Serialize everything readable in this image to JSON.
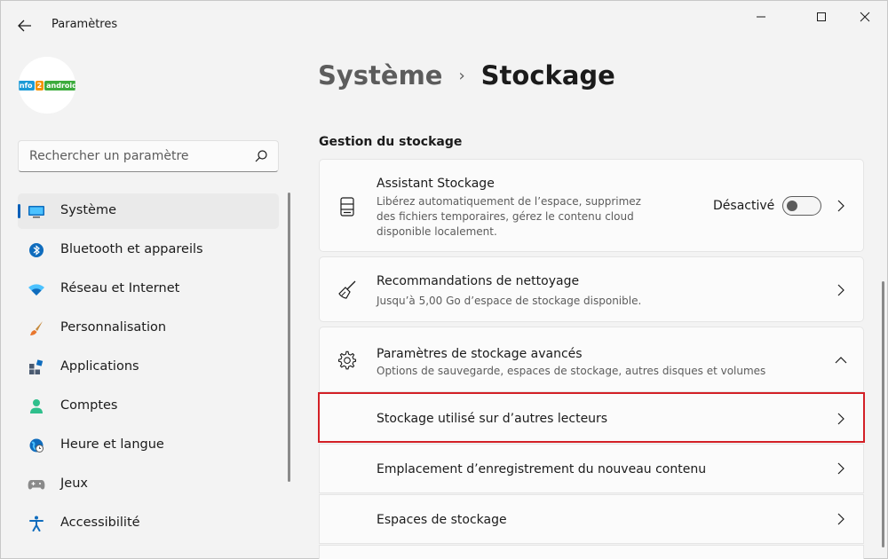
{
  "app": {
    "title": "Paramètres",
    "logo": {
      "part1": "info",
      "part2": "2",
      "part3": "android"
    }
  },
  "search": {
    "placeholder": "Rechercher un paramètre"
  },
  "sidebar": {
    "items": [
      {
        "label": "Système",
        "icon": "monitor-icon",
        "selected": true
      },
      {
        "label": "Bluetooth et appareils",
        "icon": "bluetooth-icon"
      },
      {
        "label": "Réseau et Internet",
        "icon": "wifi-icon"
      },
      {
        "label": "Personnalisation",
        "icon": "brush-icon"
      },
      {
        "label": "Applications",
        "icon": "apps-icon"
      },
      {
        "label": "Comptes",
        "icon": "person-icon"
      },
      {
        "label": "Heure et langue",
        "icon": "globe-clock-icon"
      },
      {
        "label": "Jeux",
        "icon": "gamepad-icon"
      },
      {
        "label": "Accessibilité",
        "icon": "accessibility-icon"
      }
    ]
  },
  "breadcrumb": {
    "parent": "Système",
    "separator": "›",
    "current": "Stockage"
  },
  "section": {
    "title": "Gestion du stockage"
  },
  "cards": {
    "assistant": {
      "title": "Assistant Stockage",
      "desc": "Libérez automatiquement de l’espace, supprimez des fichiers temporaires, gérez le contenu cloud disponible localement.",
      "toggle_label": "Désactivé",
      "toggle_on": false
    },
    "cleanup": {
      "title": "Recommandations de nettoyage",
      "desc": "Jusqu’à 5,00 Go d’espace de stockage disponible."
    },
    "advanced": {
      "title": "Paramètres de stockage avancés",
      "desc": "Options de sauvegarde, espaces de stockage, autres disques et volumes",
      "expanded": true,
      "rows": [
        {
          "label": "Stockage utilisé sur d’autres lecteurs",
          "highlighted": true
        },
        {
          "label": "Emplacement d’enregistrement du nouveau contenu"
        },
        {
          "label": "Espaces de stockage"
        }
      ]
    }
  },
  "colors": {
    "accent": "#005fb8",
    "highlight": "#d32026"
  }
}
